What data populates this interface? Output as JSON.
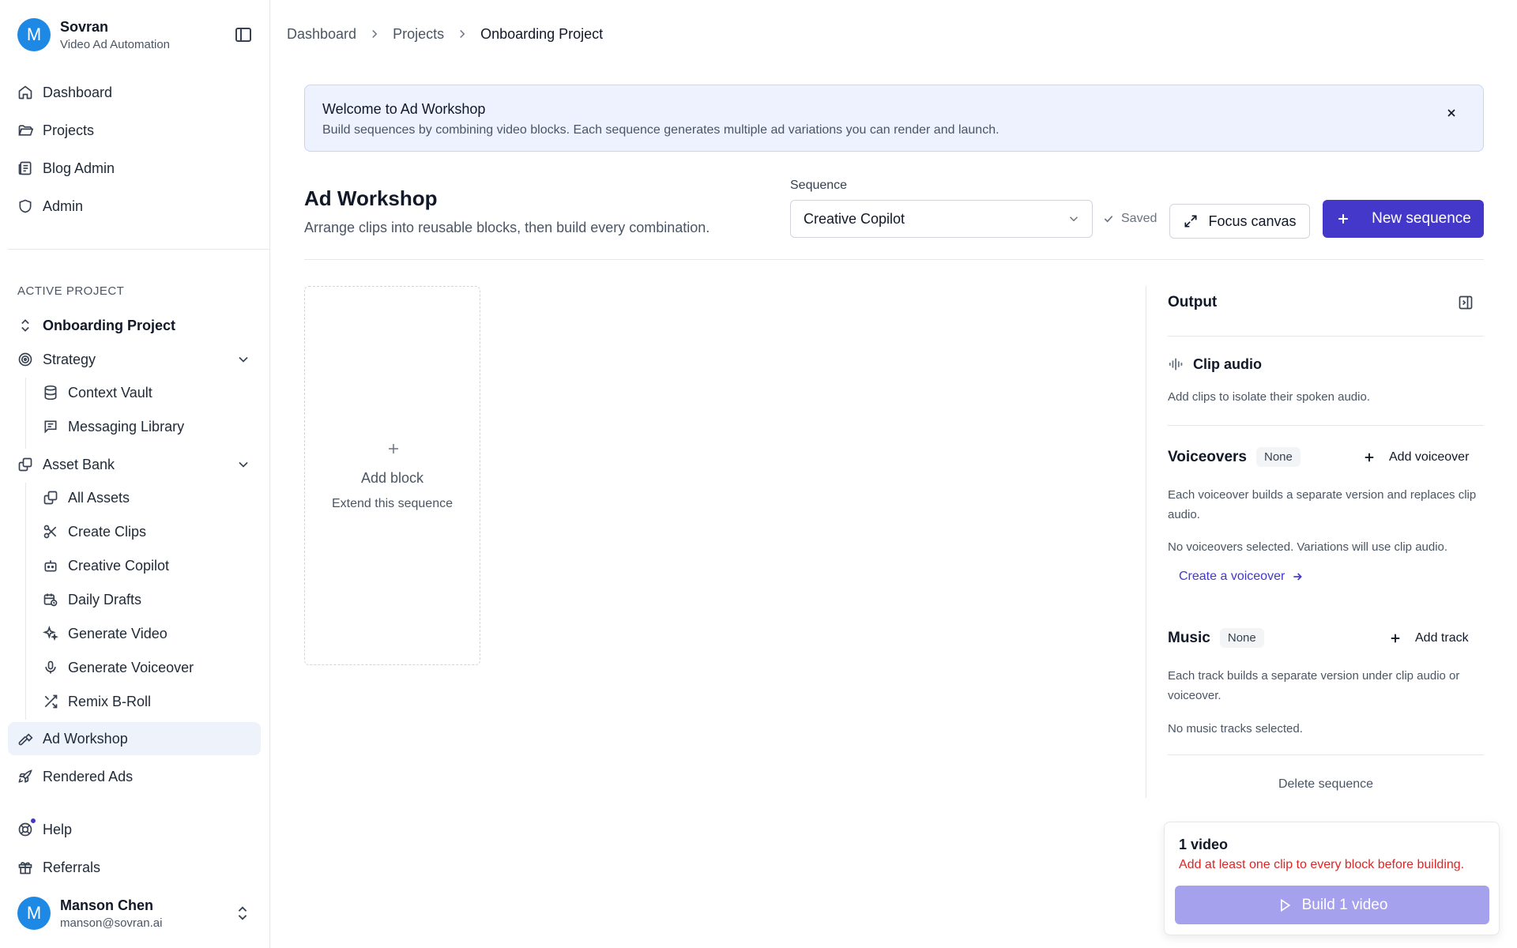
{
  "app": {
    "initial": "M",
    "name": "Sovran",
    "subtitle": "Video Ad Automation"
  },
  "nav": {
    "dashboard": "Dashboard",
    "projects": "Projects",
    "blog_admin": "Blog Admin",
    "admin": "Admin"
  },
  "active_project": {
    "section_label": "ACTIVE PROJECT",
    "name": "Onboarding Project"
  },
  "strategy": {
    "label": "Strategy",
    "items": [
      "Context Vault",
      "Messaging Library"
    ]
  },
  "asset_bank": {
    "label": "Asset Bank",
    "items": [
      "All Assets",
      "Create Clips",
      "Creative Copilot",
      "Daily Drafts",
      "Generate Video",
      "Generate Voiceover",
      "Remix B-Roll"
    ]
  },
  "nav_bottom": {
    "ad_workshop": "Ad Workshop",
    "rendered_ads": "Rendered Ads",
    "help": "Help",
    "referrals": "Referrals"
  },
  "user": {
    "initial": "M",
    "name": "Manson Chen",
    "email": "manson@sovran.ai"
  },
  "breadcrumb": [
    "Dashboard",
    "Projects",
    "Onboarding Project"
  ],
  "banner": {
    "title": "Welcome to Ad Workshop",
    "text": "Build sequences by combining video blocks. Each sequence generates multiple ad variations you can render and launch."
  },
  "page": {
    "title": "Ad Workshop",
    "subtitle": "Arrange clips into reusable blocks, then build every combination."
  },
  "sequence": {
    "label": "Sequence",
    "selected": "Creative Copilot",
    "saved_label": "Saved",
    "focus_label": "Focus canvas",
    "new_label": "New sequence"
  },
  "canvas": {
    "add_block_label": "Add block",
    "add_block_sub": "Extend this sequence"
  },
  "output": {
    "title": "Output",
    "clip_audio": {
      "title": "Clip audio",
      "text": "Add clips to isolate their spoken audio."
    },
    "voiceovers": {
      "title": "Voiceovers",
      "badge": "None",
      "action": "Add voiceover",
      "text": "Each voiceover builds a separate version and replaces clip audio.",
      "empty": "No voiceovers selected. Variations will use clip audio.",
      "link": "Create a voiceover"
    },
    "music": {
      "title": "Music",
      "badge": "None",
      "action": "Add track",
      "text": "Each track builds a separate version under clip audio or voiceover.",
      "empty": "No music tracks selected."
    },
    "delete_label": "Delete sequence"
  },
  "build": {
    "count": "1 video",
    "error": "Add at least one clip to every block before building.",
    "button": "Build 1 video"
  },
  "colors": {
    "accent": "#4338ca",
    "error": "#dc2626",
    "avatar": "#1e88e5"
  }
}
